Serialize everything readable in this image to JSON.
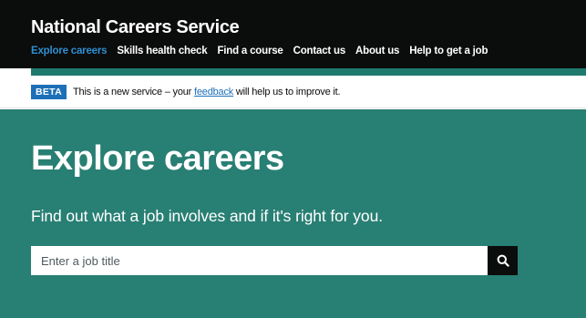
{
  "header": {
    "brand": "National Careers Service",
    "nav": [
      {
        "label": "Explore careers",
        "active": true
      },
      {
        "label": "Skills health check",
        "active": false
      },
      {
        "label": "Find a course",
        "active": false
      },
      {
        "label": "Contact us",
        "active": false
      },
      {
        "label": "About us",
        "active": false
      },
      {
        "label": "Help to get a job",
        "active": false
      }
    ]
  },
  "phase_banner": {
    "tag": "BETA",
    "text_before": "This is a new service – your ",
    "link": "feedback",
    "text_after": " will help us to improve it."
  },
  "hero": {
    "title": "Explore careers",
    "subtitle": "Find out what a job involves and if it's right for you.",
    "search": {
      "placeholder": "Enter a job title",
      "value": "",
      "button_icon": "search-icon"
    }
  },
  "colors": {
    "header_bg": "#0b0c0c",
    "active_link": "#2e8fd1",
    "hero_bg": "#287f73",
    "beta_tag": "#1d70b8"
  }
}
